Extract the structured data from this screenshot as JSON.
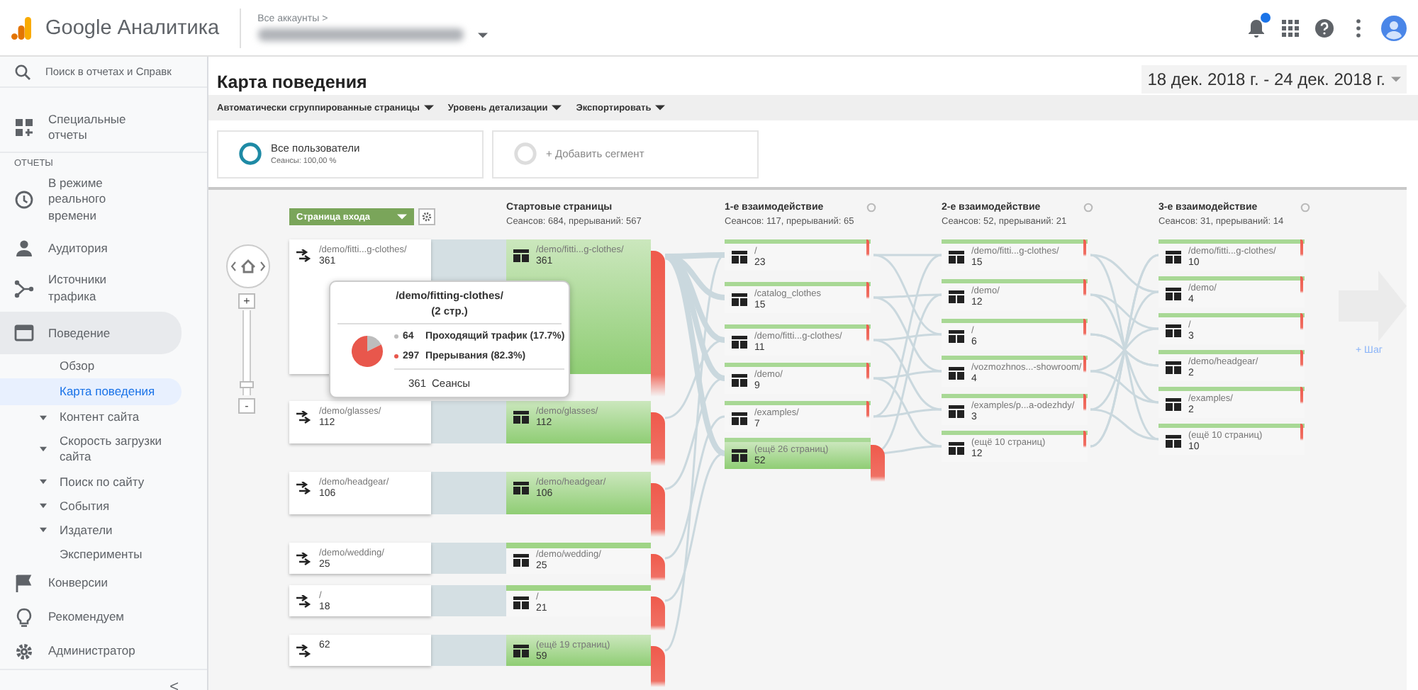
{
  "header": {
    "product": "Google Аналитика",
    "breadcrumb": "Все аккаунты >"
  },
  "sidebar": {
    "search_placeholder": "Поиск в отчетах и Справк",
    "collapse": "<",
    "items": [
      {
        "kind": "item",
        "label": "Специальные отчеты",
        "selected": false
      },
      {
        "kind": "heading",
        "label": "ОТЧЕТЫ"
      },
      {
        "kind": "item",
        "label": "В режиме реального времени",
        "selected": false
      },
      {
        "kind": "item",
        "label": "Аудитория",
        "selected": false
      },
      {
        "kind": "item",
        "label": "Источники трафика",
        "selected": false
      },
      {
        "kind": "item",
        "label": "Поведение",
        "selected": true,
        "children": [
          {
            "label": "Обзор",
            "selected": false,
            "expandable": false
          },
          {
            "label": "Карта поведения",
            "selected": true,
            "expandable": false
          },
          {
            "label": "Контент сайта",
            "selected": false,
            "expandable": true
          },
          {
            "label": "Скорость загрузки сайта",
            "selected": false,
            "expandable": true
          },
          {
            "label": "Поиск по сайту",
            "selected": false,
            "expandable": true
          },
          {
            "label": "События",
            "selected": false,
            "expandable": true
          },
          {
            "label": "Издатели",
            "selected": false,
            "expandable": true
          },
          {
            "label": "Эксперименты",
            "selected": false,
            "expandable": false
          }
        ]
      },
      {
        "kind": "item",
        "label": "Конверсии",
        "selected": false
      },
      {
        "kind": "item",
        "label": "Рекомендуем",
        "selected": false
      },
      {
        "kind": "item",
        "label": "Администратор",
        "selected": false
      }
    ]
  },
  "main": {
    "title": "Карта поведения",
    "date_range": "18 дек. 2018 г. - 24 дек. 2018 г.",
    "toolbar": [
      "Автоматически сгруппированные страницы",
      "Уровень детализации",
      "Экспортировать"
    ],
    "segments": [
      {
        "kind": "active",
        "name": "Все пользователи",
        "detail": "Сеансы: 100,00 %"
      },
      {
        "kind": "add",
        "name": "+ Добавить сегмент"
      }
    ]
  },
  "flow": {
    "dimension": "Страница входа",
    "zoom": {
      "in": "+",
      "out": "-",
      "level": 0.1
    },
    "add_step": "+ Шаг",
    "entry_nodes": [
      {
        "label": "/demo/fitti...g-clothes/",
        "count": "361"
      },
      {
        "label": "/demo/glasses/",
        "count": "112"
      },
      {
        "label": "/demo/headgear/",
        "count": "106"
      },
      {
        "label": "/demo/wedding/",
        "count": "25"
      },
      {
        "label": "/",
        "count": "18"
      },
      {
        "count": "62"
      }
    ],
    "columns": [
      {
        "kind": "start",
        "title": "Стартовые страницы",
        "summary": "Сеансов: 684, прерываний: 567",
        "nodes": [
          {
            "label": "/demo/fitti...g-clothes/",
            "count": "361",
            "highlighted": true
          },
          {
            "label": "/demo/glasses/",
            "count": "112",
            "highlighted": true
          },
          {
            "label": "/demo/headgear/",
            "count": "106",
            "highlighted": true
          },
          {
            "label": "/demo/wedding/",
            "count": "25",
            "highlighted": false
          },
          {
            "label": "/",
            "count": "21",
            "highlighted": false
          },
          {
            "label": "(ещё 19 страниц)",
            "count": "59",
            "highlighted": true
          }
        ]
      },
      {
        "kind": "interaction",
        "title": "1-е взаимодействие",
        "summary": "Сеансов: 117, прерываний: 65",
        "nodes": [
          {
            "label": "/",
            "count": "23",
            "highlighted": false
          },
          {
            "label": "/catalog_clothes",
            "count": "15",
            "highlighted": false
          },
          {
            "label": "/demo/fitti...g-clothes/",
            "count": "11",
            "highlighted": false
          },
          {
            "label": "/demo/",
            "count": "9",
            "highlighted": false
          },
          {
            "label": "/examples/",
            "count": "7",
            "highlighted": false
          },
          {
            "label": "(ещё 26 страниц)",
            "count": "52",
            "highlighted": true
          }
        ]
      },
      {
        "kind": "interaction",
        "title": "2-е взаимодействие",
        "summary": "Сеансов: 52, прерываний: 21",
        "nodes": [
          {
            "label": "/demo/fitti...g-clothes/",
            "count": "15",
            "highlighted": false
          },
          {
            "label": "/demo/",
            "count": "12",
            "highlighted": false
          },
          {
            "label": "/",
            "count": "6",
            "highlighted": false
          },
          {
            "label": "/vozmozhnos...-showroom/",
            "count": "4",
            "highlighted": false
          },
          {
            "label": "/examples/p...a-odezhdy/",
            "count": "3",
            "highlighted": false
          },
          {
            "label": "(ещё 10 страниц)",
            "count": "12",
            "highlighted": false
          }
        ]
      },
      {
        "kind": "interaction",
        "title": "3-е взаимодействие",
        "summary": "Сеансов: 31, прерываний: 14",
        "nodes": [
          {
            "label": "/demo/fitti...g-clothes/",
            "count": "10",
            "highlighted": false
          },
          {
            "label": "/demo/",
            "count": "4",
            "highlighted": false
          },
          {
            "label": "/",
            "count": "3",
            "highlighted": false
          },
          {
            "label": "/demo/headgear/",
            "count": "2",
            "highlighted": false
          },
          {
            "label": "/examples/",
            "count": "2",
            "highlighted": false
          },
          {
            "label": "(ещё 10 страниц)",
            "count": "10",
            "highlighted": false
          }
        ]
      }
    ],
    "tooltip": {
      "title": "/demo/fitting-clothes/",
      "subtitle": "(2 стр.)",
      "rows": [
        {
          "count": "64",
          "label": "Проходящий трафик (17.7%)",
          "color": "#bdbdbd"
        },
        {
          "count": "297",
          "label": "Прерывания (82.3%)",
          "color": "#e8574c"
        }
      ],
      "total_value": "361",
      "total_label": "Сеансы"
    }
  }
}
